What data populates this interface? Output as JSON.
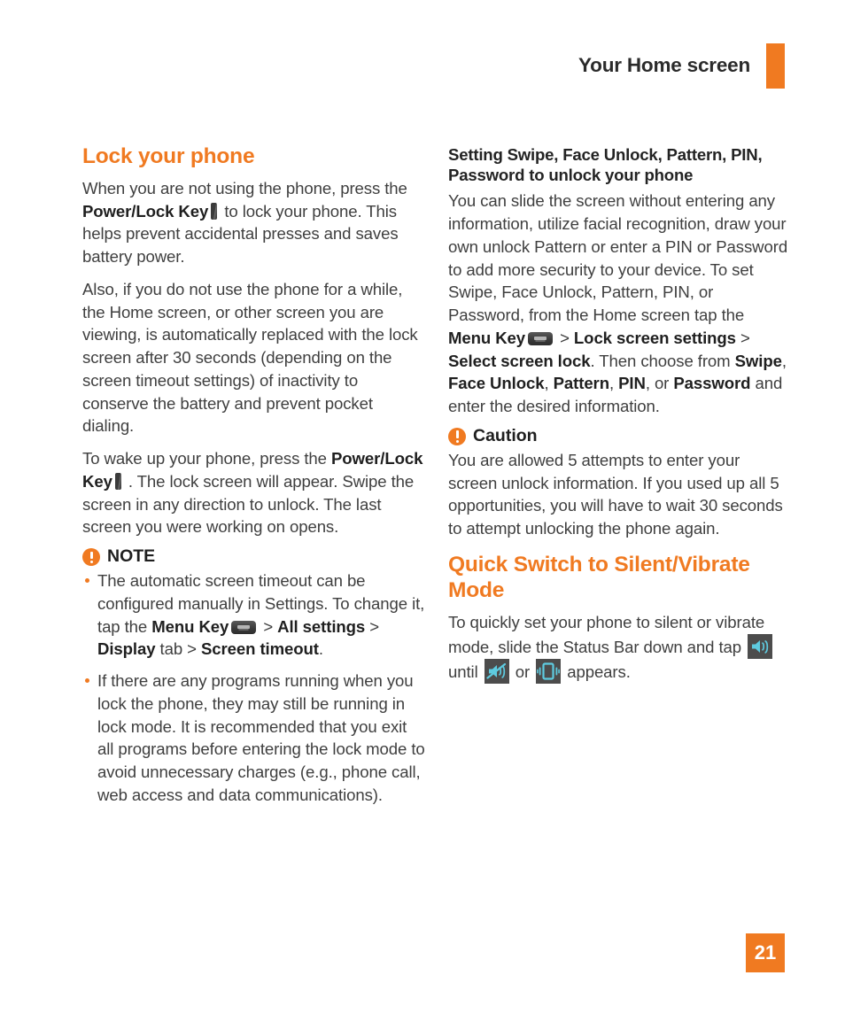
{
  "page": {
    "running_header": "Your Home screen",
    "page_number": "21",
    "accent_color": "#F07A21",
    "icon_chip_bg": "#4c4c4c",
    "icon_chip_fg": "#5ecbe0"
  },
  "left_column": {
    "section_title": "Lock your phone",
    "paragraph_1": {
      "part_1": "When you are not using the phone, press the ",
      "bold_1": "Power/Lock Key",
      "icon_1": "power-lock-key-icon",
      "part_2": " to lock your phone. This helps prevent accidental presses and saves battery power."
    },
    "paragraph_2": "Also, if you do not use the phone for a while, the Home screen, or other screen you are viewing, is automatically replaced with the lock screen after 30 seconds (depending on the screen timeout settings) of inactivity to conserve the battery and prevent pocket dialing.",
    "paragraph_3": {
      "part_1": "To wake up your phone, press the ",
      "bold_1": "Power/Lock Key",
      "icon_1": "power-lock-key-icon",
      "part_2": " . The lock screen will appear. Swipe the screen in any direction to unlock. The last screen you were working on opens."
    },
    "note": {
      "icon": "warning-icon",
      "label": "NOTE",
      "bullets": [
        {
          "part_1": "The automatic screen timeout can be configured manually in Settings. To change it, tap the ",
          "bold_1": "Menu Key",
          "icon_1": "menu-key-icon",
          "sep_1": " > ",
          "bold_2": "All settings",
          "sep_2": " > ",
          "bold_3": "Display",
          "part_2": " tab ",
          "sep_3": "> ",
          "bold_4": "Screen timeout",
          "part_3": "."
        },
        {
          "text": "If there are any programs running when you lock the phone, they may still be running in lock mode. It is recommended that you exit all programs before entering the lock mode to avoid unnecessary charges (e.g., phone call, web access and data communications)."
        }
      ]
    }
  },
  "right_column": {
    "subsection_title": "Setting Swipe, Face Unlock, Pattern, PIN, Password to unlock your phone",
    "paragraph_1": {
      "part_1": "You can slide the screen without entering any information, utilize facial recognition, draw your own unlock Pattern or enter a PIN or Password to add more security to your device. To set Swipe, Face Unlock, Pattern, PIN, or Password, from the Home screen tap the ",
      "bold_1": "Menu Key",
      "icon_1": "menu-key-icon",
      "sep_1": " > ",
      "bold_2": "Lock screen settings",
      "sep_2": " > ",
      "bold_3": "Select screen lock",
      "part_2": ". Then choose from ",
      "bold_4": "Swipe",
      "sep_3": ", ",
      "bold_5": "Face Unlock",
      "sep_4": ", ",
      "bold_6": "Pattern",
      "sep_5": ", ",
      "bold_7": "PIN",
      "sep_6": ", or ",
      "bold_8": "Password",
      "part_3": " and enter the desired information."
    },
    "caution": {
      "icon": "warning-icon",
      "label": "Caution",
      "paragraph": "You are allowed 5 attempts to enter your screen unlock information. If you used up all 5 opportunities, you will have to wait 30 seconds to attempt unlocking the phone again."
    },
    "section_title": "Quick Switch to Silent/Vibrate Mode",
    "paragraph_2": {
      "part_1": "To quickly set your phone to silent or vibrate mode, slide the Status Bar down and tap ",
      "icon_1": "speaker-on-icon",
      "part_2": " until ",
      "icon_2": "speaker-mute-icon",
      "part_3": " or ",
      "icon_3": "vibrate-icon",
      "part_4": " appears."
    }
  }
}
